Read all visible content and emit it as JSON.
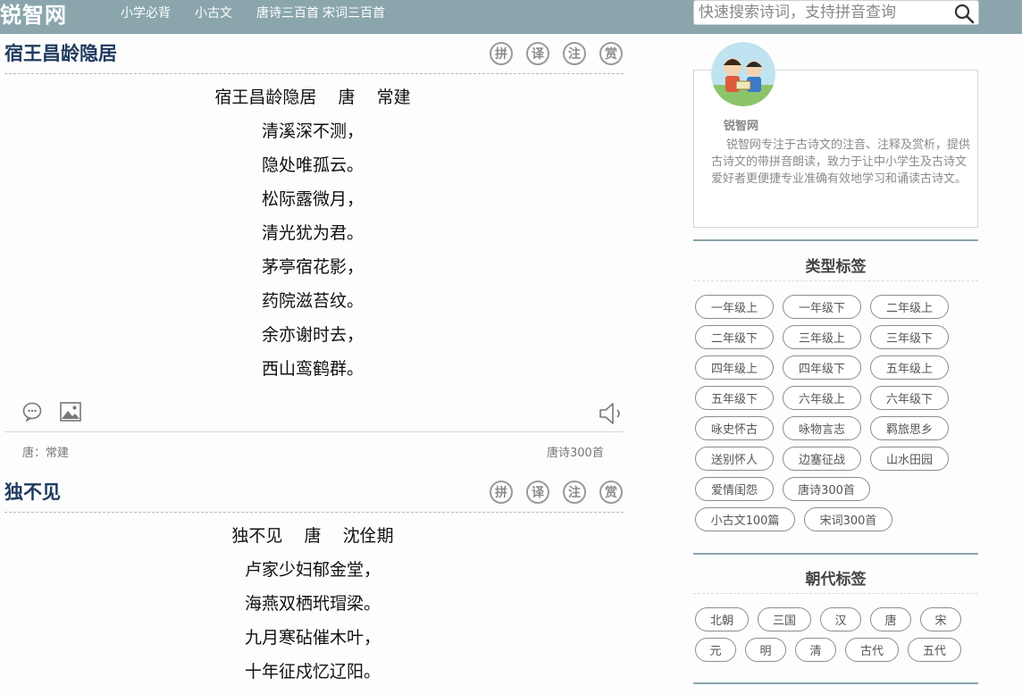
{
  "header": {
    "logo": "锐智网",
    "nav": [
      "小学必背",
      "小古文",
      "唐诗三百首",
      "宋词三百首"
    ],
    "search_placeholder": "快速搜索诗词，支持拼音查询"
  },
  "tools": [
    "拼",
    "译",
    "注",
    "赏"
  ],
  "poems": [
    {
      "title": "宿王昌龄隐居",
      "head": "宿王昌龄隐居    唐    常建",
      "lines": [
        "清溪深不测，",
        "隐处唯孤云。",
        "松际露微月，",
        "清光犹为君。",
        "茅亭宿花影，",
        "药院滋苔纹。",
        "余亦谢时去，",
        "西山鸾鹤群。"
      ],
      "author": "唐：常建",
      "tag": "唐诗300首"
    },
    {
      "title": "独不见",
      "head": "独不见    唐    沈佺期",
      "lines": [
        "卢家少妇郁金堂，",
        "海燕双栖玳瑁梁。",
        "九月寒砧催木叶，",
        "十年征戍忆辽阳。"
      ]
    }
  ],
  "profile": {
    "name": "锐智网",
    "desc": "锐智网专注于古诗文的注音、注释及赏析，提供古诗文的带拼音朗读，致力于让中小学生及古诗文爱好者更便捷专业准确有效地学习和诵读古诗文。"
  },
  "type_tags": {
    "title": "类型标签",
    "tags": [
      "一年级上",
      "一年级下",
      "二年级上",
      "二年级下",
      "三年级上",
      "三年级下",
      "四年级上",
      "四年级下",
      "五年级上",
      "五年级下",
      "六年级上",
      "六年级下",
      "咏史怀古",
      "咏物言志",
      "羁旅思乡",
      "送别怀人",
      "边塞征战",
      "山水田园",
      "爱情闺怨",
      "唐诗300首",
      "小古文100篇",
      "宋词300首"
    ]
  },
  "dynasty_tags": {
    "title": "朝代标签",
    "tags": [
      "北朝",
      "三国",
      "汉",
      "唐",
      "宋",
      "元",
      "明",
      "清",
      "古代",
      "五代"
    ]
  },
  "colors": {
    "header_bg": "#8aa6ac",
    "title_blue": "#1e3a5f"
  }
}
